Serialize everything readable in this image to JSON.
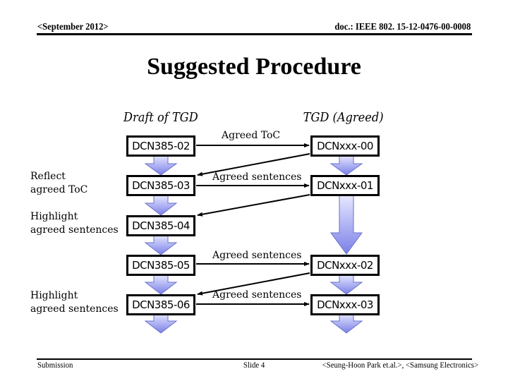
{
  "header": {
    "date": "<September 2012>",
    "doc_id": "doc.: IEEE 802. 15-12-0476-00-0008"
  },
  "title": "Suggested Procedure",
  "columns": {
    "left_heading": "Draft of TGD",
    "right_heading": "TGD (Agreed)"
  },
  "draft_boxes": [
    "DCN385-02",
    "DCN385-03",
    "DCN385-04",
    "DCN385-05",
    "DCN385-06"
  ],
  "agreed_boxes": [
    "DCNxxx-00",
    "DCNxxx-01",
    "DCNxxx-02",
    "DCNxxx-03"
  ],
  "side_labels": [
    {
      "line1": "Reflect",
      "line2": "agreed ToC"
    },
    {
      "line1": "Highlight",
      "line2": "agreed sentences"
    },
    {
      "line1": "Highlight",
      "line2": "agreed sentences"
    }
  ],
  "edge_labels": [
    "Agreed ToC",
    "Agreed sentences",
    "Agreed sentences",
    "Agreed sentences"
  ],
  "colors": {
    "arrow_top": "#e6e8ff",
    "arrow_bottom": "#7b80e8",
    "arrow_stroke": "#6a70c8"
  },
  "footer": {
    "left": "Submission",
    "center": "Slide 4",
    "right": "<Seung-Hoon Park et.al.>, <Samsung Electronics>"
  }
}
